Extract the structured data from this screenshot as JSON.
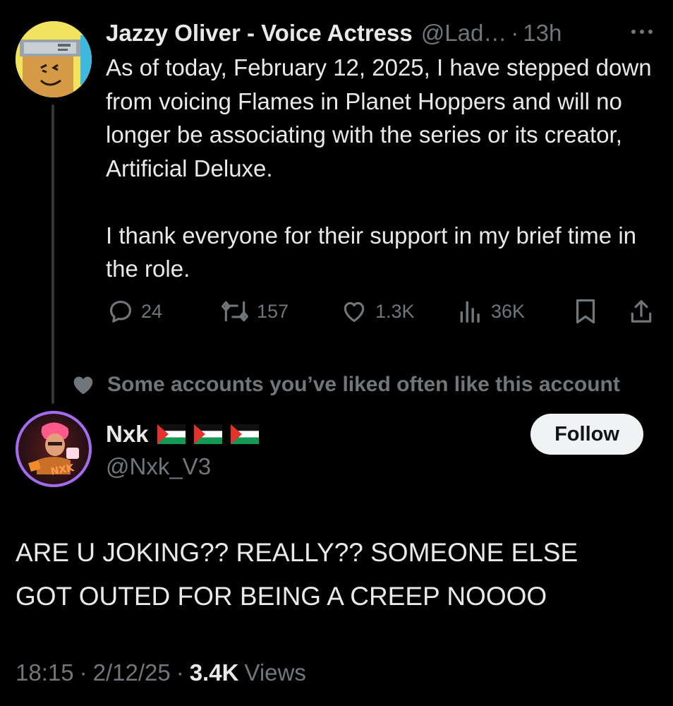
{
  "tweet": {
    "author_name": "Jazzy Oliver - Voice Actress",
    "handle": "@Lad…",
    "dot": "·",
    "time": "13h",
    "paragraphs": [
      "As of today, February 12, 2025, I have stepped down from voicing Flames in Planet Hoppers and will no longer be associating with the series or its creator, Artificial Deluxe.",
      "I thank everyone for their support in my brief time in the role."
    ],
    "actions": {
      "replies": "24",
      "reposts": "157",
      "likes": "1.3K",
      "views": "36K"
    },
    "icons": [
      "more-icon",
      "reply-icon",
      "repost-icon",
      "like-icon",
      "views-icon",
      "bookmark-icon",
      "share-icon"
    ]
  },
  "social_context": {
    "text": "Some accounts you’ve liked often like this account",
    "icon": "heart-icon"
  },
  "reply": {
    "author_name": "Nxk",
    "flags_count": 3,
    "handle": "@Nxk_V3",
    "follow_label": "Follow",
    "text_lines": [
      "ARE U JOKING?? REALLY?? SOMEONE ELSE",
      "GOT OUTED FOR BEING A CREEP NOOOO"
    ],
    "time": "18:15",
    "date": "2/12/25",
    "dot": "·",
    "views_count": "3.4K",
    "views_label": "Views"
  },
  "colors": {
    "background": "#000000",
    "text": "#e7e9ea",
    "muted": "#71767b",
    "thread_line": "#333639",
    "follow_bg": "#eff3f4"
  }
}
